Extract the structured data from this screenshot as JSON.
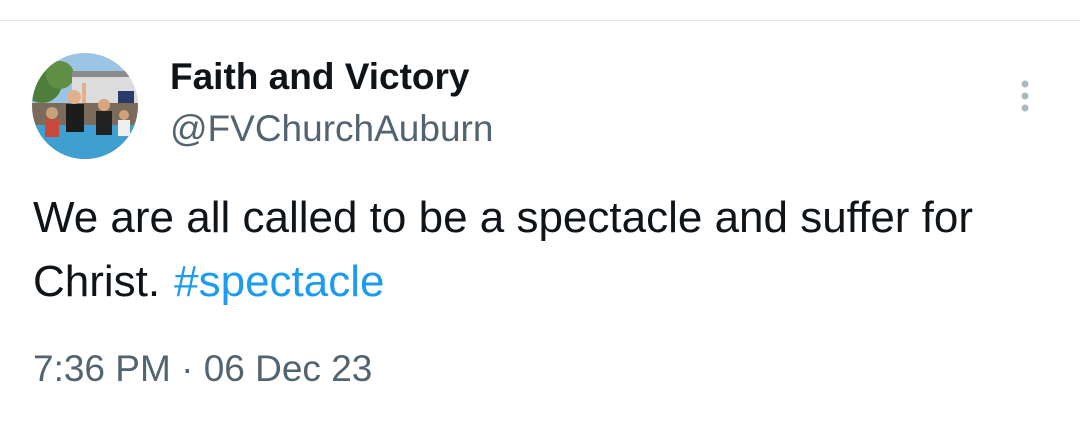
{
  "author": {
    "display_name": "Faith and Victory",
    "handle": "@FVChurchAuburn"
  },
  "tweet": {
    "text": "We are all called to be a spectacle and suffer for Christ.",
    "hashtag": "#spectacle"
  },
  "meta": {
    "time": "7:36 PM",
    "separator": "·",
    "date": "06 Dec 23"
  },
  "icons": {
    "more": "more-vertical-icon",
    "avatar": "avatar-photo"
  },
  "colors": {
    "text_primary": "#0f1419",
    "text_secondary": "#536471",
    "link": "#1d9bf0",
    "divider": "#e6e6e6"
  }
}
